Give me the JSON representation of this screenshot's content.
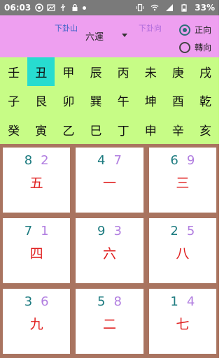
{
  "status_bar": {
    "time": "06:03",
    "battery": "33%"
  },
  "header": {
    "down_mountain_label": "下卦山",
    "down_direction_label": "下卦向",
    "period_select_value": "六運",
    "radio_forward_label": "正向",
    "radio_reverse_label": "轉向",
    "selected_radio": "正向"
  },
  "stems": {
    "rows": [
      [
        "壬",
        "丑",
        "甲",
        "辰",
        "丙",
        "未",
        "庚",
        "戌"
      ],
      [
        "子",
        "艮",
        "卯",
        "巽",
        "午",
        "坤",
        "酉",
        "乾"
      ],
      [
        "癸",
        "寅",
        "乙",
        "巳",
        "丁",
        "申",
        "辛",
        "亥"
      ]
    ],
    "selected": "丑"
  },
  "palaces": [
    {
      "mountain": "8",
      "facing": "2",
      "star": "五"
    },
    {
      "mountain": "4",
      "facing": "7",
      "star": "一"
    },
    {
      "mountain": "6",
      "facing": "9",
      "star": "三"
    },
    {
      "mountain": "7",
      "facing": "1",
      "star": "四"
    },
    {
      "mountain": "9",
      "facing": "3",
      "star": "六"
    },
    {
      "mountain": "2",
      "facing": "5",
      "star": "八"
    },
    {
      "mountain": "3",
      "facing": "6",
      "star": "九"
    },
    {
      "mountain": "5",
      "facing": "8",
      "star": "二"
    },
    {
      "mountain": "1",
      "facing": "4",
      "star": "七"
    }
  ]
}
